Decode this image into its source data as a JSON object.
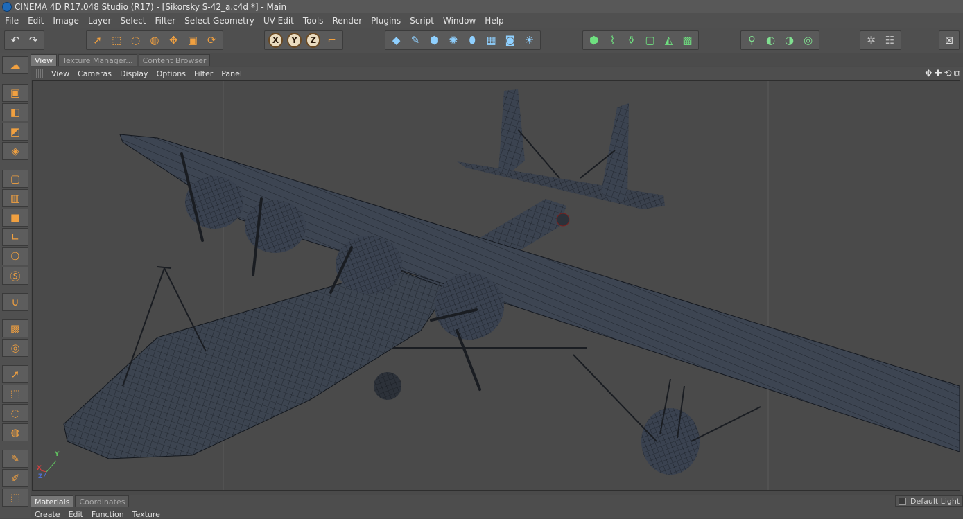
{
  "window": {
    "title": "CINEMA 4D R17.048 Studio (R17) - [Sikorsky S-42_a.c4d *] - Main"
  },
  "menu": [
    "File",
    "Edit",
    "Image",
    "Layer",
    "Select",
    "Filter",
    "Select Geometry",
    "UV Edit",
    "Tools",
    "Render",
    "Plugins",
    "Script",
    "Window",
    "Help"
  ],
  "toolbar": {
    "history": [
      {
        "name": "undo",
        "icon": "↶"
      },
      {
        "name": "redo",
        "icon": "↷"
      }
    ],
    "modes": [
      {
        "name": "live-selection",
        "icon": "➚"
      },
      {
        "name": "rectangle-select",
        "icon": "⬚"
      },
      {
        "name": "lasso-select",
        "icon": "◌"
      },
      {
        "name": "polygon-select",
        "icon": "◍"
      },
      {
        "name": "move",
        "icon": "✥"
      },
      {
        "name": "scale",
        "icon": "▣"
      },
      {
        "name": "rotate",
        "icon": "⟳"
      }
    ],
    "axes": [
      "X",
      "Y",
      "Z"
    ],
    "coord_icon": "⌐",
    "create": [
      {
        "name": "cube",
        "icon": "◆"
      },
      {
        "name": "pen",
        "icon": "✎"
      },
      {
        "name": "subdivision",
        "icon": "⬢"
      },
      {
        "name": "array",
        "icon": "✺"
      },
      {
        "name": "deformer",
        "icon": "⬮"
      },
      {
        "name": "floor",
        "icon": "▦"
      },
      {
        "name": "camera",
        "icon": "◙"
      },
      {
        "name": "light",
        "icon": "☀"
      }
    ],
    "modeling": [
      {
        "name": "object-mode",
        "icon": "⬢"
      },
      {
        "name": "edge-mode",
        "icon": "⌇"
      },
      {
        "name": "point-mode",
        "icon": "⚱"
      },
      {
        "name": "texture-mode",
        "icon": "▢"
      },
      {
        "name": "plane-mode",
        "icon": "◭"
      },
      {
        "name": "uv-mode",
        "icon": "▩"
      }
    ],
    "snapping": [
      {
        "name": "snap",
        "icon": "⚲"
      },
      {
        "name": "workplane",
        "icon": "◐"
      },
      {
        "name": "symmetry",
        "icon": "◑"
      },
      {
        "name": "soft-selection",
        "icon": "◎"
      }
    ],
    "extra": [
      {
        "name": "settings",
        "icon": "✲"
      },
      {
        "name": "hud",
        "icon": "☷"
      }
    ],
    "layout_icon": "⊠"
  },
  "left_tools": [
    {
      "name": "model",
      "icon": "☁"
    },
    {
      "name": "object",
      "icon": "▣"
    },
    {
      "name": "mesh",
      "icon": "◧"
    },
    {
      "name": "texture",
      "icon": "◩"
    },
    {
      "name": "workplane",
      "icon": "◈"
    },
    {
      "name": "points",
      "icon": "▢"
    },
    {
      "name": "edges",
      "icon": "▥"
    },
    {
      "name": "polygons",
      "icon": "■"
    },
    {
      "name": "axis",
      "icon": "∟"
    },
    {
      "name": "tweak",
      "icon": "❍"
    },
    {
      "name": "soft-snap",
      "icon": "Ⓢ"
    },
    {
      "name": "magnet",
      "icon": "∪"
    },
    {
      "name": "lock",
      "icon": "▩"
    },
    {
      "name": "gravity",
      "icon": "◎"
    },
    {
      "name": "select-live",
      "icon": "➚"
    },
    {
      "name": "select-rect",
      "icon": "⬚"
    },
    {
      "name": "select-lasso",
      "icon": "◌"
    },
    {
      "name": "select-poly",
      "icon": "◍"
    },
    {
      "name": "paint",
      "icon": "✎"
    },
    {
      "name": "eyedropper",
      "icon": "✐"
    },
    {
      "name": "select-box",
      "icon": "⬚"
    }
  ],
  "viewport_tabs": [
    {
      "label": "View",
      "active": true
    },
    {
      "label": "Texture Manager...",
      "active": false
    },
    {
      "label": "Content Browser",
      "active": false
    }
  ],
  "viewport_menu": [
    "View",
    "Cameras",
    "Display",
    "Options",
    "Filter",
    "Panel"
  ],
  "viewport_icons": [
    {
      "name": "pan",
      "icon": "✥"
    },
    {
      "name": "dolly",
      "icon": "✚"
    },
    {
      "name": "orbit",
      "icon": "⟲"
    },
    {
      "name": "maximize",
      "icon": "⧉"
    }
  ],
  "axis_labels": {
    "x": "X",
    "y": "Y",
    "z": "Z"
  },
  "colors": {
    "axis_x": "#d04040",
    "axis_y": "#60c060",
    "axis_z": "#5070d0",
    "accent": "#e8902a"
  },
  "bottom": {
    "tabs": [
      {
        "label": "Materials",
        "active": true
      },
      {
        "label": "Coordinates",
        "active": false
      }
    ],
    "menu": [
      "Create",
      "Edit",
      "Function",
      "Texture"
    ],
    "default_light": "Default Light"
  }
}
